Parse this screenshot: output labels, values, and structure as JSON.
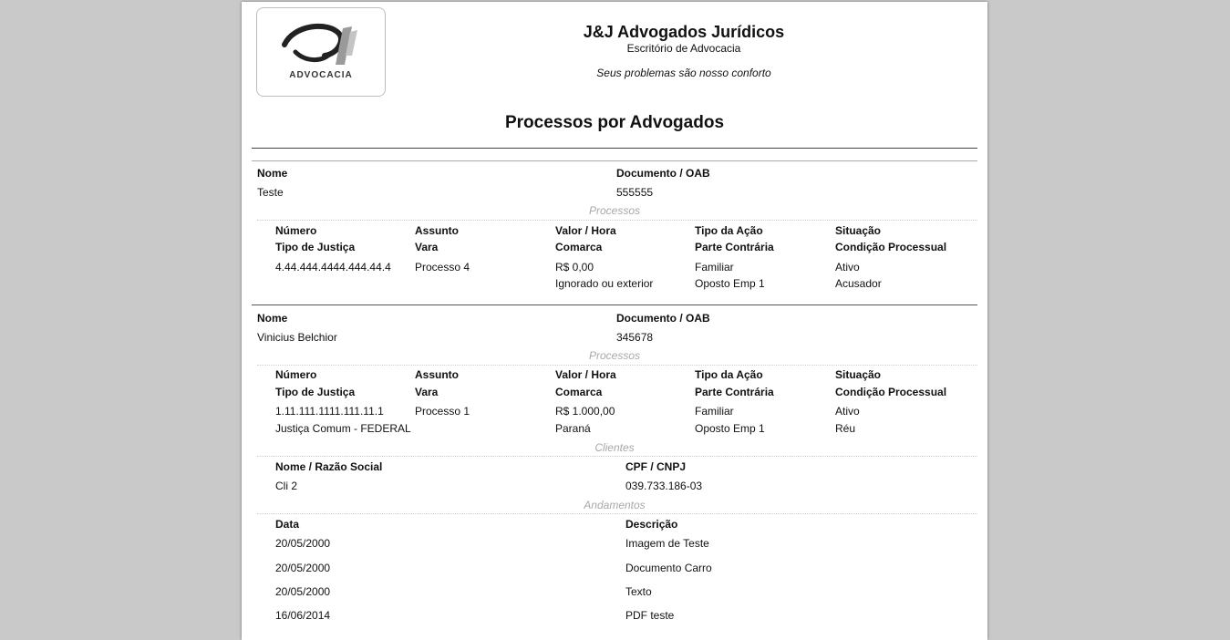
{
  "header": {
    "logo_text": "Advocacia",
    "company_name": "J&J Advogados Jurídicos",
    "subtitle": "Escritório de Advocacia",
    "slogan": "Seus problemas são nosso conforto",
    "report_title": "Processos por Advogados"
  },
  "labels": {
    "nome": "Nome",
    "documento_oab": "Documento / OAB",
    "processos": "Processos",
    "clientes": "Clientes",
    "andamentos": "Andamentos",
    "numero": "Número",
    "assunto": "Assunto",
    "valor_hora": "Valor / Hora",
    "tipo_acao": "Tipo da Ação",
    "situacao": "Situação",
    "tipo_justica": "Tipo de Justiça",
    "vara": "Vara",
    "comarca": "Comarca",
    "parte_contraria": "Parte Contrária",
    "condicao_processual": "Condição Processual",
    "nome_razao_social": "Nome / Razão Social",
    "cpf_cnpj": "CPF / CNPJ",
    "data": "Data",
    "descricao": "Descrição"
  },
  "lawyers": [
    {
      "nome": "Teste",
      "documento": "555555",
      "processo": {
        "numero": "4.44.444.4444.444.44.4",
        "assunto": "Processo 4",
        "valor_hora": "R$ 0,00",
        "tipo_acao": "Familiar",
        "situacao": "Ativo",
        "tipo_justica": "",
        "vara": "",
        "comarca": "Ignorado ou exterior",
        "parte_contraria": "Oposto Emp 1",
        "condicao_processual": "Acusador"
      }
    },
    {
      "nome": "Vinicius Belchior",
      "documento": "345678",
      "processo": {
        "numero": "1.11.111.1111.111.11.1",
        "assunto": "Processo 1",
        "valor_hora": "R$ 1.000,00",
        "tipo_acao": "Familiar",
        "situacao": "Ativo",
        "tipo_justica": "Justiça Comum - FEDERAL",
        "vara": "",
        "comarca": "Paraná",
        "parte_contraria": "Oposto Emp 1",
        "condicao_processual": "Réu"
      },
      "cliente": {
        "nome": "Cli 2",
        "cpf_cnpj": "039.733.186-03"
      },
      "andamentos": [
        {
          "data": "20/05/2000",
          "descricao": "Imagem de Teste"
        },
        {
          "data": "20/05/2000",
          "descricao": "Documento Carro"
        },
        {
          "data": "20/05/2000",
          "descricao": "Texto"
        },
        {
          "data": "16/06/2014",
          "descricao": "PDF teste"
        }
      ]
    }
  ]
}
